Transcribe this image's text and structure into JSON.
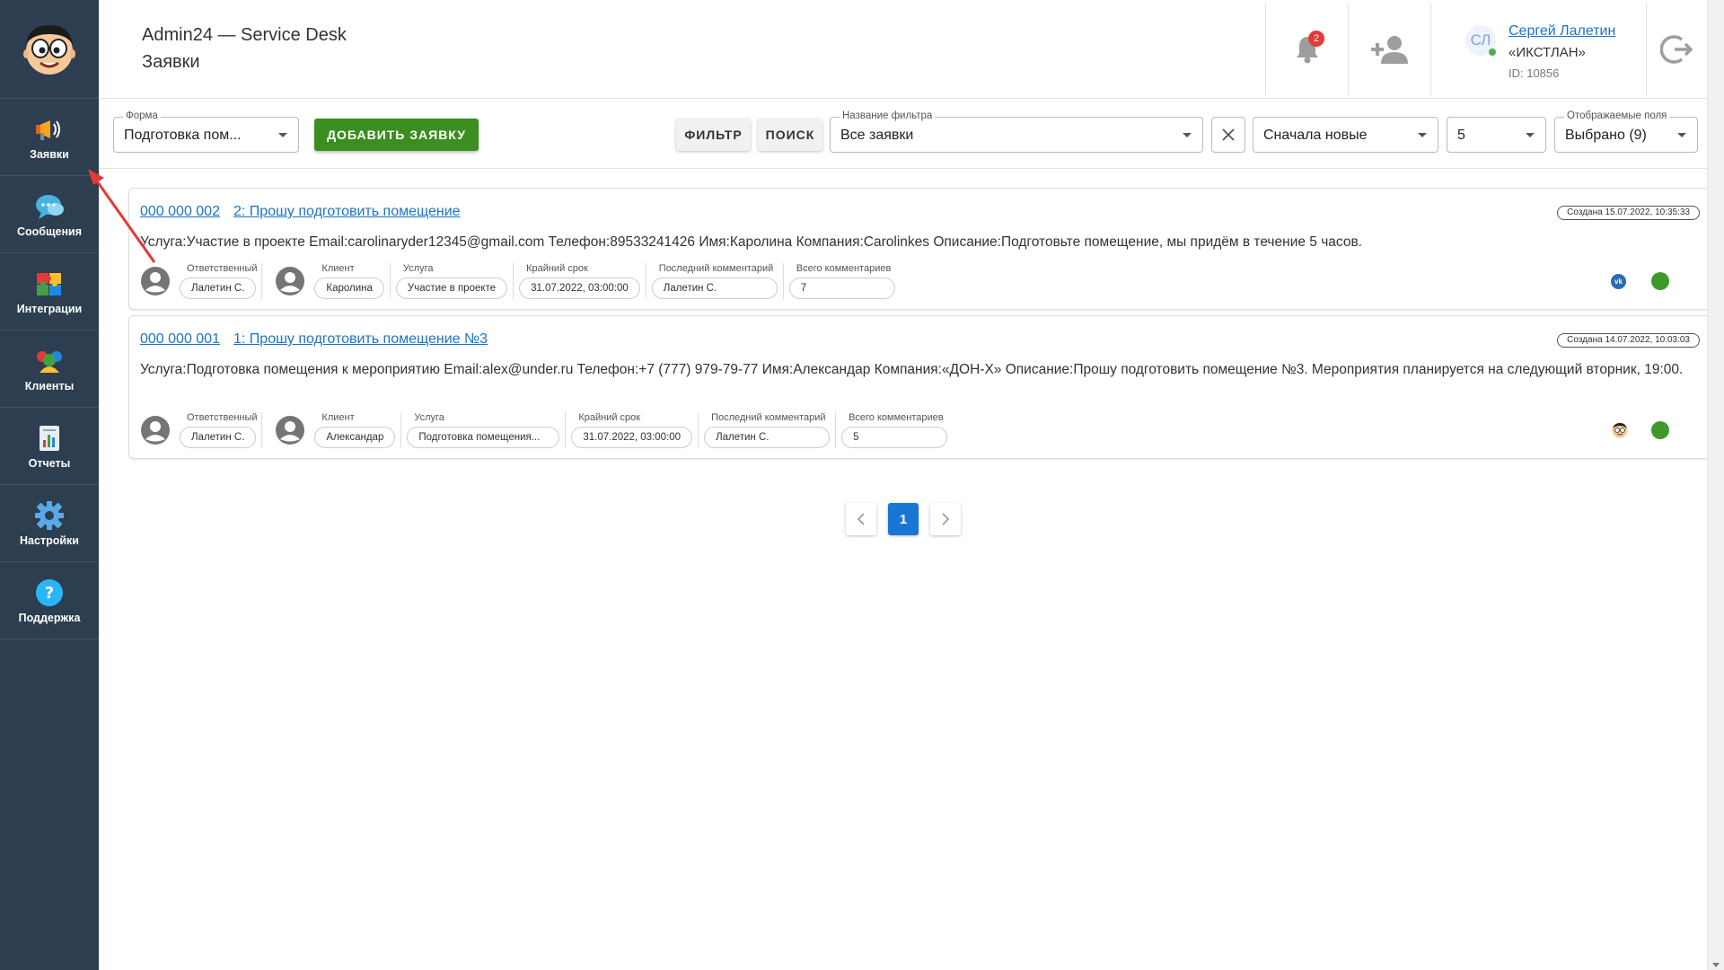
{
  "sidebar": {
    "items": [
      {
        "label": "Заявки",
        "icon": "megaphone-icon"
      },
      {
        "label": "Сообщения",
        "icon": "chat-bubble-icon"
      },
      {
        "label": "Интеграции",
        "icon": "puzzle-icon"
      },
      {
        "label": "Клиенты",
        "icon": "users-icon"
      },
      {
        "label": "Отчеты",
        "icon": "report-icon"
      },
      {
        "label": "Настройки",
        "icon": "gear-icon"
      },
      {
        "label": "Поддержка",
        "icon": "question-icon"
      }
    ]
  },
  "header": {
    "app_title": "Admin24 — Service Desk",
    "page_title": "Заявки",
    "notifications_count": "2",
    "user": {
      "initials": "СЛ",
      "name": "Сергей Лалетин",
      "company": "«ИКСТЛАН»",
      "id": "ID: 10856"
    }
  },
  "toolbar": {
    "form_label": "Форма",
    "form_value": "Подготовка пом...",
    "add_button": "ДОБАВИТЬ ЗАЯВКУ",
    "filter_button": "ФИЛЬТР",
    "search_button": "ПОИСК",
    "filter_name_label": "Название фильтра",
    "filter_name_value": "Все заявки",
    "sort_value": "Сначала новые",
    "per_page_value": "5",
    "fields_label": "Отображаемые поля",
    "fields_value": "Выбрано (9)"
  },
  "tickets": [
    {
      "number": "000 000 002",
      "title": "2: Прошу подготовить помещение",
      "created": "Создана 15.07.2022, 10:35:33",
      "description": "Услуга:Участие в проекте Email:carolinaryder12345@gmail.com Телефон:89533241426 Имя:Каролина Компания:Carolinkes Описание:Подготовьте помещение, мы придём в течение 5 часов.",
      "labels": {
        "responsible": "Ответственный",
        "client": "Клиент",
        "service": "Услуга",
        "deadline": "Крайний срок",
        "last_comment": "Последний комментарий",
        "total_comments": "Всего комментариев"
      },
      "responsible": "Лалетин С.",
      "client": "Каролина",
      "service": "Участие в проекте",
      "deadline": "31.07.2022, 03:00:00",
      "last_comment": "Лалетин С.",
      "total_comments": "7",
      "channel_icon": "vk-icon",
      "channel_text": "vk",
      "status_color": "#3f9a2b"
    },
    {
      "number": "000 000 001",
      "title": "1: Прошу подготовить помещение №3",
      "created": "Создана 14.07.2022, 10:03:03",
      "description": "Услуга:Подготовка помещения к мероприятию Email:alex@under.ru Телефон:+7 (777) 979-79-77 Имя:Александар Компания:«ДОН-Х» Описание:Прошу подготовить помещение №3. Мероприятия планируется на следующий вторник, 19:00.",
      "labels": {
        "responsible": "Ответственный",
        "client": "Клиент",
        "service": "Услуга",
        "deadline": "Крайний срок",
        "last_comment": "Последний комментарий",
        "total_comments": "Всего комментариев"
      },
      "responsible": "Лалетин С.",
      "client": "Александар",
      "service": "Подготовка помещения...",
      "deadline": "31.07.2022, 03:00:00",
      "last_comment": "Лалетин С.",
      "total_comments": "5",
      "channel_icon": "widget-avatar-icon",
      "status_color": "#3f9a2b"
    }
  ],
  "pagination": {
    "current": "1"
  },
  "colors": {
    "sidebar_bg": "#2c3e50",
    "accent_green": "#3b8e1f",
    "link_blue": "#1a73c9",
    "pagination_active": "#1976d2"
  }
}
